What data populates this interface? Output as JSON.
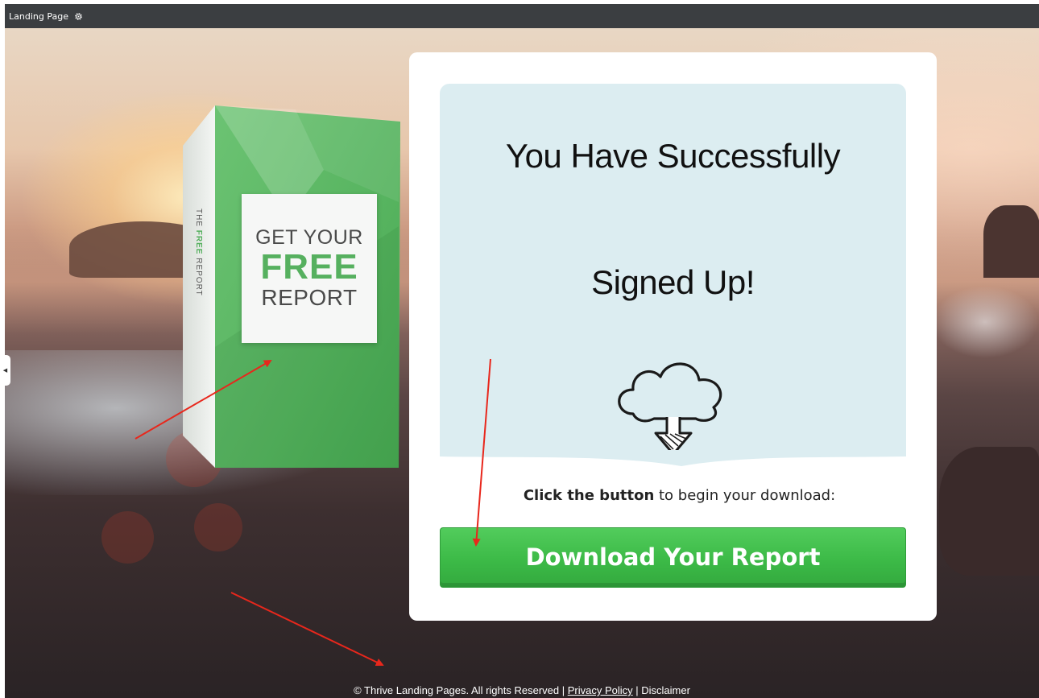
{
  "toolbar": {
    "title": "Landing Page",
    "settings_icon": "gear-icon"
  },
  "product_box": {
    "spine_prefix": "THE",
    "spine_highlight": "FREE",
    "spine_suffix": "REPORT",
    "line1": "GET YOUR",
    "line2": "FREE",
    "line3": "REPORT",
    "accent_color": "#56b05f"
  },
  "card": {
    "headline_line1": "You Have Successfully",
    "headline_line2": "Signed Up!",
    "icon": "cloud-download-icon",
    "instruction_bold": "Click the button",
    "instruction_rest": " to begin your download:",
    "button_label": "Download Your Report",
    "button_color": "#3cba47",
    "panel_color": "#dcedf1"
  },
  "footer": {
    "copyright": "© Thrive Landing Pages. All rights Reserved | ",
    "privacy_link": "Privacy Policy",
    "separator": " | ",
    "disclaimer": "Disclaimer"
  },
  "annotations": {
    "arrow_color": "#e8271c",
    "arrow_icon": "red-arrow-annotation"
  }
}
